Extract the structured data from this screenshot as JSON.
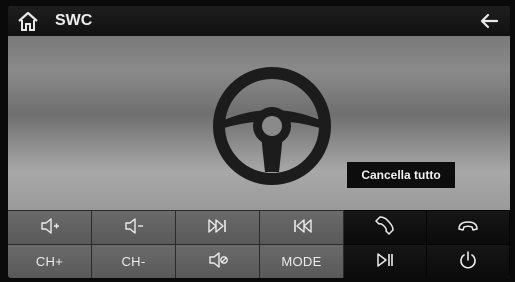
{
  "header": {
    "title": "SWC",
    "home_icon": "home-icon",
    "back_icon": "back-arrow-icon"
  },
  "main": {
    "steering_wheel_icon": "steering-wheel-icon",
    "clear_all_label": "Cancella tutto"
  },
  "keys": {
    "row1": [
      {
        "name": "volume-up-key",
        "icon": "volume-up-icon"
      },
      {
        "name": "volume-down-key",
        "icon": "volume-down-icon"
      },
      {
        "name": "next-track-key",
        "icon": "next-track-icon"
      },
      {
        "name": "previous-track-key",
        "icon": "previous-track-icon"
      },
      {
        "name": "phone-answer-key",
        "icon": "phone-answer-icon"
      },
      {
        "name": "phone-hangup-key",
        "icon": "phone-hangup-icon"
      }
    ],
    "row2": [
      {
        "name": "channel-up-key",
        "label": "CH+"
      },
      {
        "name": "channel-down-key",
        "label": "CH-"
      },
      {
        "name": "mute-key",
        "icon": "mute-icon"
      },
      {
        "name": "mode-key",
        "label": "MODE"
      },
      {
        "name": "play-pause-key",
        "icon": "play-pause-icon"
      },
      {
        "name": "power-key",
        "icon": "power-icon"
      }
    ]
  },
  "colors": {
    "header_bg": "#151515",
    "key_grey": "#616161",
    "key_dark": "#0f0f0f",
    "text": "#ececec"
  }
}
